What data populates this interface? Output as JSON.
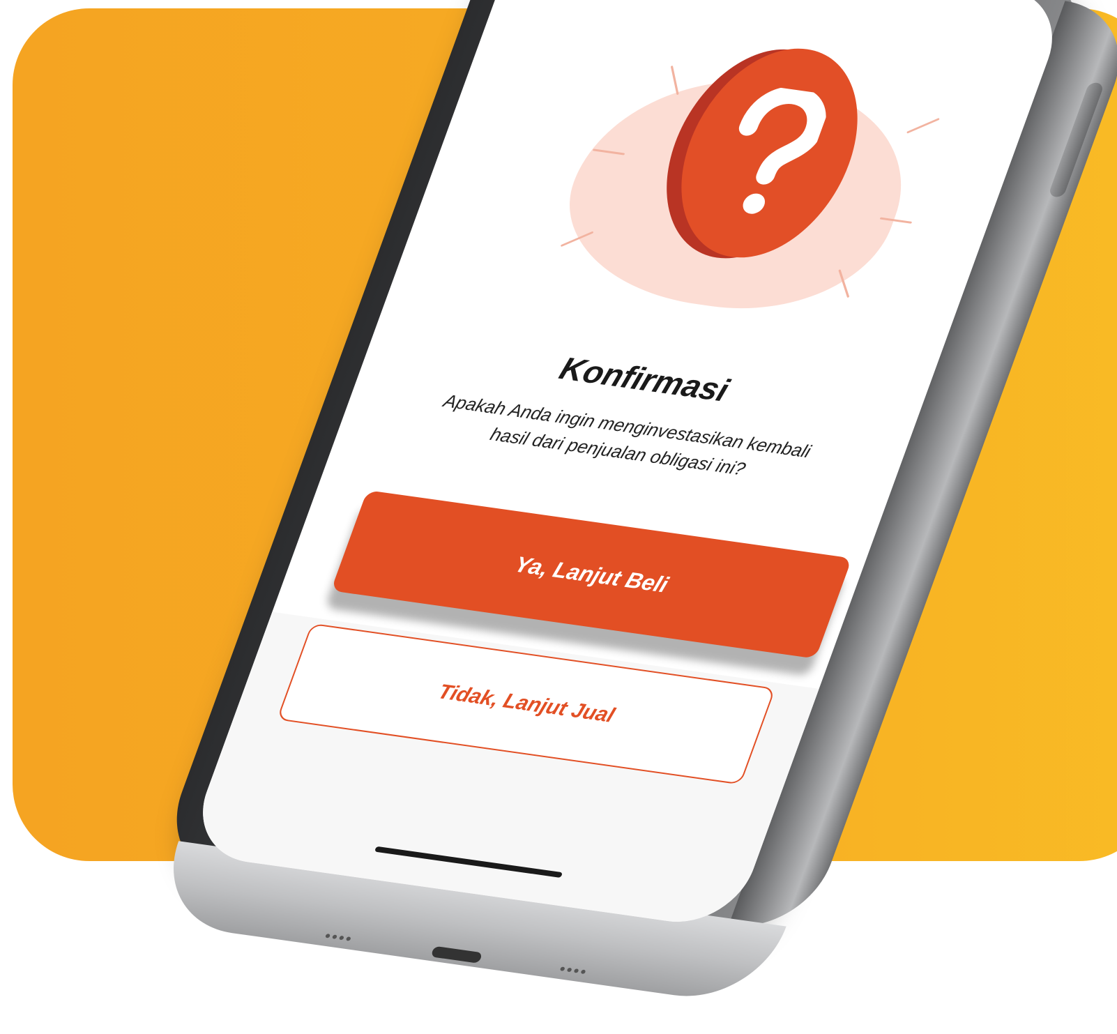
{
  "dialog": {
    "title": "Konfirmasi",
    "message": "Apakah Anda ingin menginvestasikan kembali hasil dari penjualan obligasi ini?"
  },
  "buttons": {
    "primary_label": "Ya, Lanjut Beli",
    "secondary_label": "Tidak, Lanjut Jual"
  },
  "illustration": {
    "icon": "question-mark-icon"
  },
  "colors": {
    "accent": "#e24f24",
    "background_panel": "#f6aa23",
    "illustration_blob": "#fcddd4"
  }
}
